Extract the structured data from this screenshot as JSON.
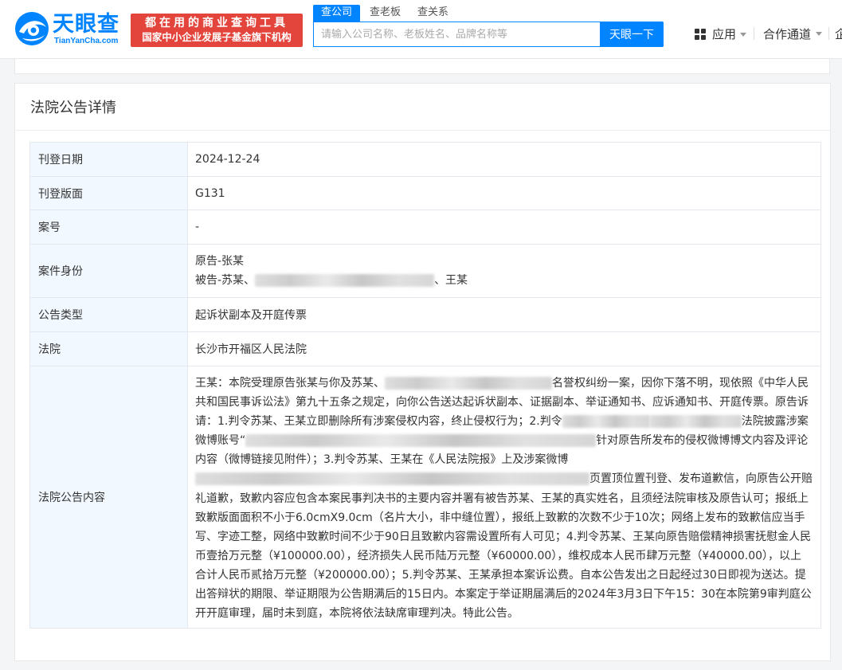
{
  "header": {
    "logo_cn": "天眼查",
    "logo_en": "TianYanCha.com",
    "slogan_line1": "都在用的商业查询工具",
    "slogan_line2": "国家中小企业发展子基金旗下机构",
    "search_tabs": [
      "查公司",
      "查老板",
      "查关系"
    ],
    "search_placeholder": "请输入公司名称、老板姓名、品牌名称等",
    "search_button": "天眼一下",
    "nav_apps": "应用",
    "nav_coop": "合作通道",
    "nav_more": "企"
  },
  "colors": {
    "brand": "#0084ff",
    "slogan_bg": "#e3443b",
    "key_bg": "#f2f8ff"
  },
  "card": {
    "title": "法院公告详情",
    "rows": {
      "date_label": "刊登日期",
      "date_value": "2024-12-24",
      "page_label": "刊登版面",
      "page_value": "G131",
      "case_no_label": "案号",
      "case_no_value": "-",
      "identity_label": "案件身份",
      "identity_line1": "原告-张某",
      "identity_line2_a": "被告-苏某、",
      "identity_line2_b": "、王某",
      "type_label": "公告类型",
      "type_value": "起诉状副本及开庭传票",
      "court_label": "法院",
      "court_value": "长沙市开福区人民法院",
      "content_label": "法院公告内容"
    },
    "content": {
      "p1": "王某：本院受理原告张某与你及苏某、",
      "p2": "名誉权纠纷一案，因你下落不明，现依照《中华人民共和国民事诉讼法》第九十五条之规定，向你公告送达起诉状副本、证据副本、举证通知书、应诉通知书、开庭传票。原告诉请：1.判令苏某、王某立即删除所有涉案侵权内容，终止侵权行为；2.判令",
      "p3": "法院披露涉案微博账号“",
      "p4": "针对原告所发布的侵权微博博文内容及评论内容（微博链接见附件）；3.判令苏某、王某在《人民法院报》上及涉案微博",
      "p5": "页置顶位置刊登、发布道歉信，向原告公开赔礼道歉，致歉内容应包含本案民事判决书的主要内容并署有被告苏某、王某的真实姓名，且须经法院审核及原告认可；报纸上致歉版面面积不小于6.0cmX9.0cm（名片大小，非中缝位置），报纸上致歉的次数不少于10次；网络上发布的致歉信应当手写、字迹工整，网络中致歉时间不少于90日且致歉内容需设置所有人可见；4.判令苏某、王某向原告赔偿精神损害抚慰金人民币壹拾万元整（¥100000.00），经济损失人民币陆万元整（¥60000.00），维权成本人民币肆万元整（¥40000.00），以上合计人民币贰拾万元整（¥200000.00）；5.判令苏某、王某承担本案诉讼费。自本公告发出之日起经过30日即视为送达。提出答辩状的期限、举证期限为公告期满后的15日内。本案定于举证期届满后的2024年3月3日下午15：30在本院第9审判庭公开开庭审理，届时未到庭，本院将依法缺席审理判决。特此公告。"
    }
  }
}
